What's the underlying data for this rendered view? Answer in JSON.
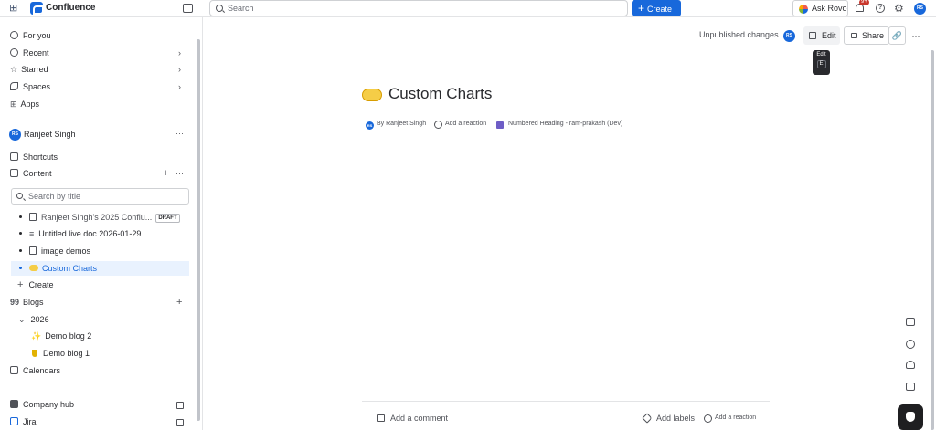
{
  "topbar": {
    "brand": "Confluence",
    "search_placeholder": "Search",
    "create_label": "Create",
    "ask_rovo_label": "Ask Rovo",
    "notification_badge": "9+",
    "user_initials": "RS"
  },
  "sidebar": {
    "nav": [
      {
        "label": "For you",
        "icon": "person-circle-icon"
      },
      {
        "label": "Recent",
        "icon": "clock-icon"
      },
      {
        "label": "Starred",
        "icon": "star-icon"
      },
      {
        "label": "Spaces",
        "icon": "spaces-icon"
      },
      {
        "label": "Apps",
        "icon": "apps-icon"
      }
    ],
    "space_user_initials": "RS",
    "space_user_name": "Ranjeet Singh",
    "shortcuts_label": "Shortcuts",
    "content_label": "Content",
    "filter_placeholder": "Search by title",
    "tree": [
      {
        "label": "Ranjeet Singh's 2025 Conflu...",
        "badge": "DRAFT"
      },
      {
        "label": "Untitled live doc 2026-01-29"
      },
      {
        "label": "image demos"
      },
      {
        "label": "Custom Charts"
      }
    ],
    "create_label": "Create",
    "blogs_label": "Blogs",
    "blog_year": "2026",
    "blog_posts": [
      {
        "label": "Demo blog 2"
      },
      {
        "label": "Demo blog 1"
      }
    ],
    "calendars_label": "Calendars",
    "company_hub_label": "Company hub",
    "jira_label": "Jira"
  },
  "page": {
    "status": "Unpublished changes",
    "author_initials": "RS",
    "edit_label": "Edit",
    "share_label": "Share",
    "tooltip_label": "Edit",
    "tooltip_key": "E",
    "title": "Custom Charts",
    "byline": "By Ranjeet Singh",
    "add_reaction": "Add a reaction",
    "heading_macro": "Numbered Heading - ram-prakash (Dev)",
    "add_comment": "Add a comment",
    "add_labels": "Add labels",
    "add_reaction_footer": "Add a reaction"
  }
}
